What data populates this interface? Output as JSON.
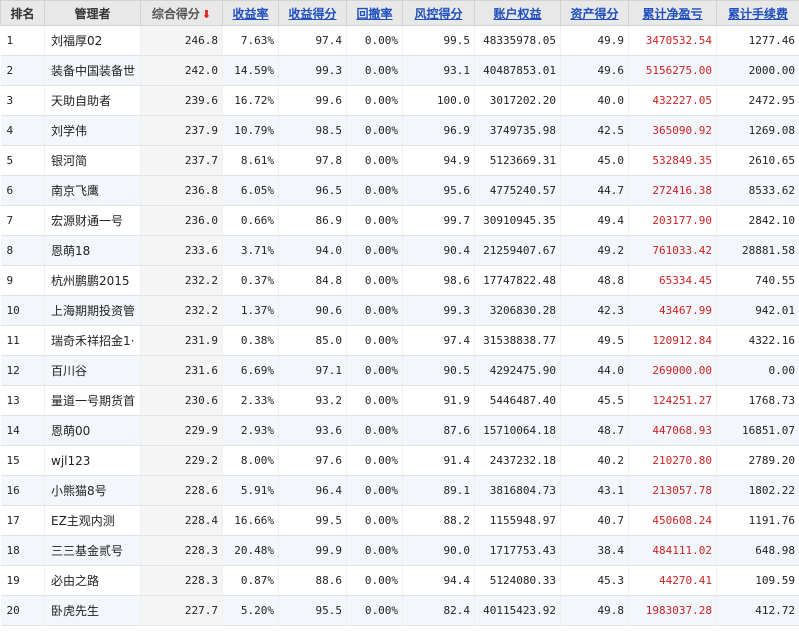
{
  "headers": {
    "rank": "排名",
    "manager": "管理者",
    "total_score": "综合得分",
    "return_rate": "收益率",
    "return_score": "收益得分",
    "drawdown": "回撤率",
    "risk_score": "风控得分",
    "equity": "账户权益",
    "asset_score": "资产得分",
    "cum_pnl": "累计净盈亏",
    "cum_fee": "累计手续费"
  },
  "rows": [
    {
      "rank": "1",
      "name": "刘福厚02",
      "score": "246.8",
      "ret": "7.63%",
      "ret_score": "97.4",
      "dd": "0.00%",
      "risk": "99.5",
      "equity": "48335978.05",
      "asset": "49.9",
      "pnl": "3470532.54",
      "fee": "1277.46"
    },
    {
      "rank": "2",
      "name": "装备中国装备世",
      "score": "242.0",
      "ret": "14.59%",
      "ret_score": "99.3",
      "dd": "0.00%",
      "risk": "93.1",
      "equity": "40487853.01",
      "asset": "49.6",
      "pnl": "5156275.00",
      "fee": "2000.00"
    },
    {
      "rank": "3",
      "name": "天助自助者",
      "score": "239.6",
      "ret": "16.72%",
      "ret_score": "99.6",
      "dd": "0.00%",
      "risk": "100.0",
      "equity": "3017202.20",
      "asset": "40.0",
      "pnl": "432227.05",
      "fee": "2472.95"
    },
    {
      "rank": "4",
      "name": "刘学伟",
      "score": "237.9",
      "ret": "10.79%",
      "ret_score": "98.5",
      "dd": "0.00%",
      "risk": "96.9",
      "equity": "3749735.98",
      "asset": "42.5",
      "pnl": "365090.92",
      "fee": "1269.08"
    },
    {
      "rank": "5",
      "name": "银河简",
      "score": "237.7",
      "ret": "8.61%",
      "ret_score": "97.8",
      "dd": "0.00%",
      "risk": "94.9",
      "equity": "5123669.31",
      "asset": "45.0",
      "pnl": "532849.35",
      "fee": "2610.65"
    },
    {
      "rank": "6",
      "name": "南京飞鹰",
      "score": "236.8",
      "ret": "6.05%",
      "ret_score": "96.5",
      "dd": "0.00%",
      "risk": "95.6",
      "equity": "4775240.57",
      "asset": "44.7",
      "pnl": "272416.38",
      "fee": "8533.62"
    },
    {
      "rank": "7",
      "name": "宏源财通一号",
      "score": "236.0",
      "ret": "0.66%",
      "ret_score": "86.9",
      "dd": "0.00%",
      "risk": "99.7",
      "equity": "30910945.35",
      "asset": "49.4",
      "pnl": "203177.90",
      "fee": "2842.10"
    },
    {
      "rank": "8",
      "name": "恩萌18",
      "score": "233.6",
      "ret": "3.71%",
      "ret_score": "94.0",
      "dd": "0.00%",
      "risk": "90.4",
      "equity": "21259407.67",
      "asset": "49.2",
      "pnl": "761033.42",
      "fee": "28881.58"
    },
    {
      "rank": "9",
      "name": "杭州鹏鹏2015",
      "score": "232.2",
      "ret": "0.37%",
      "ret_score": "84.8",
      "dd": "0.00%",
      "risk": "98.6",
      "equity": "17747822.48",
      "asset": "48.8",
      "pnl": "65334.45",
      "fee": "740.55"
    },
    {
      "rank": "10",
      "name": "上海期期投资管",
      "score": "232.2",
      "ret": "1.37%",
      "ret_score": "90.6",
      "dd": "0.00%",
      "risk": "99.3",
      "equity": "3206830.28",
      "asset": "42.3",
      "pnl": "43467.99",
      "fee": "942.01"
    },
    {
      "rank": "11",
      "name": "瑞奇禾祥招金1·",
      "score": "231.9",
      "ret": "0.38%",
      "ret_score": "85.0",
      "dd": "0.00%",
      "risk": "97.4",
      "equity": "31538838.77",
      "asset": "49.5",
      "pnl": "120912.84",
      "fee": "4322.16"
    },
    {
      "rank": "12",
      "name": "百川谷",
      "score": "231.6",
      "ret": "6.69%",
      "ret_score": "97.1",
      "dd": "0.00%",
      "risk": "90.5",
      "equity": "4292475.90",
      "asset": "44.0",
      "pnl": "269000.00",
      "fee": "0.00"
    },
    {
      "rank": "13",
      "name": "量道一号期货首",
      "score": "230.6",
      "ret": "2.33%",
      "ret_score": "93.2",
      "dd": "0.00%",
      "risk": "91.9",
      "equity": "5446487.40",
      "asset": "45.5",
      "pnl": "124251.27",
      "fee": "1768.73"
    },
    {
      "rank": "14",
      "name": "恩萌00",
      "score": "229.9",
      "ret": "2.93%",
      "ret_score": "93.6",
      "dd": "0.00%",
      "risk": "87.6",
      "equity": "15710064.18",
      "asset": "48.7",
      "pnl": "447068.93",
      "fee": "16851.07"
    },
    {
      "rank": "15",
      "name": "wjl123",
      "score": "229.2",
      "ret": "8.00%",
      "ret_score": "97.6",
      "dd": "0.00%",
      "risk": "91.4",
      "equity": "2437232.18",
      "asset": "40.2",
      "pnl": "210270.80",
      "fee": "2789.20"
    },
    {
      "rank": "16",
      "name": "小熊猫8号",
      "score": "228.6",
      "ret": "5.91%",
      "ret_score": "96.4",
      "dd": "0.00%",
      "risk": "89.1",
      "equity": "3816804.73",
      "asset": "43.1",
      "pnl": "213057.78",
      "fee": "1802.22"
    },
    {
      "rank": "17",
      "name": "EZ主观内测",
      "score": "228.4",
      "ret": "16.66%",
      "ret_score": "99.5",
      "dd": "0.00%",
      "risk": "88.2",
      "equity": "1155948.97",
      "asset": "40.7",
      "pnl": "450608.24",
      "fee": "1191.76"
    },
    {
      "rank": "18",
      "name": "三三基金贰号",
      "score": "228.3",
      "ret": "20.48%",
      "ret_score": "99.9",
      "dd": "0.00%",
      "risk": "90.0",
      "equity": "1717753.43",
      "asset": "38.4",
      "pnl": "484111.02",
      "fee": "648.98"
    },
    {
      "rank": "19",
      "name": "必由之路",
      "score": "228.3",
      "ret": "0.87%",
      "ret_score": "88.6",
      "dd": "0.00%",
      "risk": "94.4",
      "equity": "5124080.33",
      "asset": "45.3",
      "pnl": "44270.41",
      "fee": "109.59"
    },
    {
      "rank": "20",
      "name": "卧虎先生",
      "score": "227.7",
      "ret": "5.20%",
      "ret_score": "95.5",
      "dd": "0.00%",
      "risk": "82.4",
      "equity": "40115423.92",
      "asset": "49.8",
      "pnl": "1983037.28",
      "fee": "412.72"
    }
  ],
  "colors": {
    "header_bg": "#e8e8e8",
    "link_blue": "#1f4fbf",
    "pnl_red": "#cc2222",
    "sort_arrow_red": "#e02020",
    "row_alt_bg": "#f3f7fb"
  },
  "icons": {
    "sort": "sort-desc-arrow-icon"
  }
}
